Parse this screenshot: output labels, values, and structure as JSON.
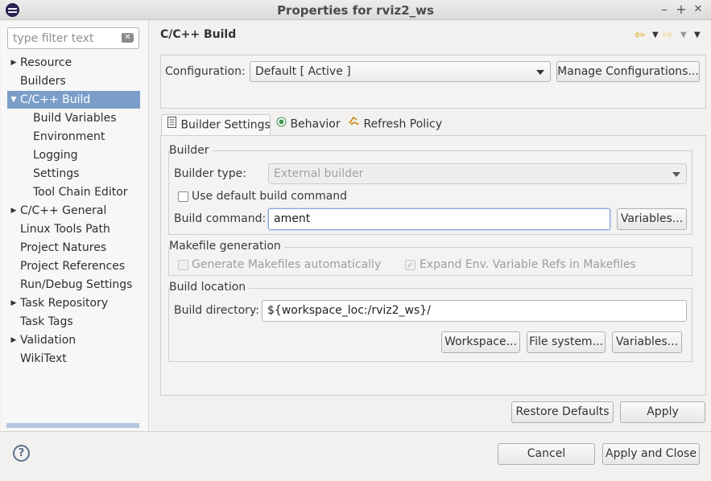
{
  "window": {
    "title": "Properties for rviz2_ws",
    "controls": {
      "minimize": "–",
      "maximize": "+",
      "close": "✕"
    }
  },
  "filter": {
    "placeholder": "type filter text",
    "value": ""
  },
  "tree": [
    {
      "label": "Resource",
      "level": 0,
      "expandable": true,
      "expanded": false
    },
    {
      "label": "Builders",
      "level": 0,
      "expandable": false
    },
    {
      "label": "C/C++ Build",
      "level": 0,
      "expandable": true,
      "expanded": true,
      "selected": true
    },
    {
      "label": "Build Variables",
      "level": 1
    },
    {
      "label": "Environment",
      "level": 1
    },
    {
      "label": "Logging",
      "level": 1
    },
    {
      "label": "Settings",
      "level": 1
    },
    {
      "label": "Tool Chain Editor",
      "level": 1
    },
    {
      "label": "C/C++ General",
      "level": 0,
      "expandable": true,
      "expanded": false
    },
    {
      "label": "Linux Tools Path",
      "level": 0,
      "expandable": false
    },
    {
      "label": "Project Natures",
      "level": 0,
      "expandable": false
    },
    {
      "label": "Project References",
      "level": 0,
      "expandable": false
    },
    {
      "label": "Run/Debug Settings",
      "level": 0,
      "expandable": false
    },
    {
      "label": "Task Repository",
      "level": 0,
      "expandable": true,
      "expanded": false
    },
    {
      "label": "Task Tags",
      "level": 0,
      "expandable": false
    },
    {
      "label": "Validation",
      "level": 0,
      "expandable": true,
      "expanded": false
    },
    {
      "label": "WikiText",
      "level": 0,
      "expandable": false
    }
  ],
  "page": {
    "title": "C/C++ Build",
    "configuration_label": "Configuration:",
    "configuration_value": "Default  [ Active ]",
    "manage_configurations": "Manage Configurations..."
  },
  "tabs": [
    {
      "label": "Builder Settings",
      "icon": "document-icon",
      "active": true
    },
    {
      "label": "Behavior",
      "icon": "radio-icon",
      "active": false
    },
    {
      "label": "Refresh Policy",
      "icon": "refresh-icon",
      "active": false
    }
  ],
  "builder": {
    "group_title": "Builder",
    "type_label": "Builder type:",
    "type_value": "External builder",
    "use_default_label": "Use default build command",
    "use_default_checked": false,
    "command_label": "Build command:",
    "command_value": "ament",
    "variables_button": "Variables..."
  },
  "makefile": {
    "group_title": "Makefile generation",
    "generate_label": "Generate Makefiles automatically",
    "generate_checked": false,
    "expand_label": "Expand Env. Variable Refs in Makefiles",
    "expand_checked": true
  },
  "location": {
    "group_title": "Build location",
    "directory_label": "Build directory:",
    "directory_value": "${workspace_loc:/rviz2_ws}/",
    "workspace_button": "Workspace...",
    "filesystem_button": "File system...",
    "variables_button": "Variables..."
  },
  "footer": {
    "restore_defaults": "Restore Defaults",
    "apply": "Apply",
    "cancel": "Cancel",
    "apply_and_close": "Apply and Close"
  }
}
